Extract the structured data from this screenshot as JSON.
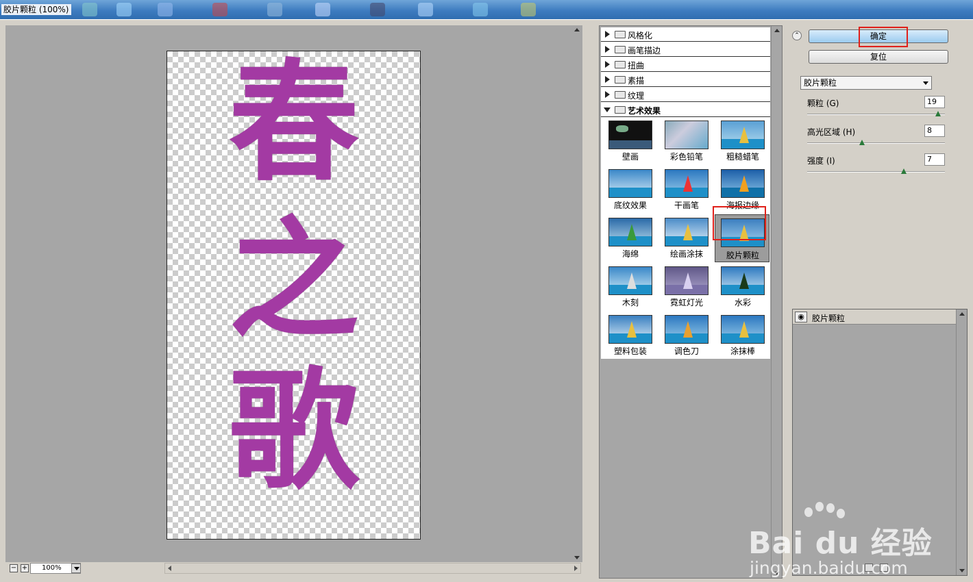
{
  "window": {
    "title": "胶片颗粒 (100%)"
  },
  "preview": {
    "glyphs": [
      "春",
      "之",
      "歌"
    ],
    "zoom": "100%",
    "zoom_out": "−",
    "zoom_in": "+"
  },
  "filter_tree": {
    "categories": [
      {
        "label": "风格化",
        "expanded": false
      },
      {
        "label": "画笔描边",
        "expanded": false
      },
      {
        "label": "扭曲",
        "expanded": false
      },
      {
        "label": "素描",
        "expanded": false
      },
      {
        "label": "纹理",
        "expanded": false
      },
      {
        "label": "艺术效果",
        "expanded": true
      }
    ],
    "filters": [
      "壁画",
      "彩色铅笔",
      "粗糙蜡笔",
      "底纹效果",
      "干画笔",
      "海报边缘",
      "海绵",
      "绘画涂抹",
      "胶片颗粒",
      "木刻",
      "霓虹灯光",
      "水彩",
      "塑料包装",
      "调色刀",
      "涂抹棒"
    ],
    "selected": "胶片颗粒"
  },
  "settings": {
    "ok_label": "确定",
    "reset_label": "复位",
    "filter_select": "胶片颗粒",
    "params": [
      {
        "label": "颗粒 (G)",
        "value": "19",
        "max": 20
      },
      {
        "label": "高光区域 (H)",
        "value": "8",
        "max": 20
      },
      {
        "label": "强度 (I)",
        "value": "7",
        "max": 10
      }
    ]
  },
  "layers": {
    "items": [
      {
        "label": "胶片颗粒",
        "visible": true
      }
    ]
  },
  "watermark": {
    "brand": "Bai du 经验",
    "url": "jingyan.baidu.com"
  },
  "colors": {
    "accent_red": "#e0201a",
    "glyph_purple": "#a33aa3",
    "ok_button": "#9ccbef"
  }
}
